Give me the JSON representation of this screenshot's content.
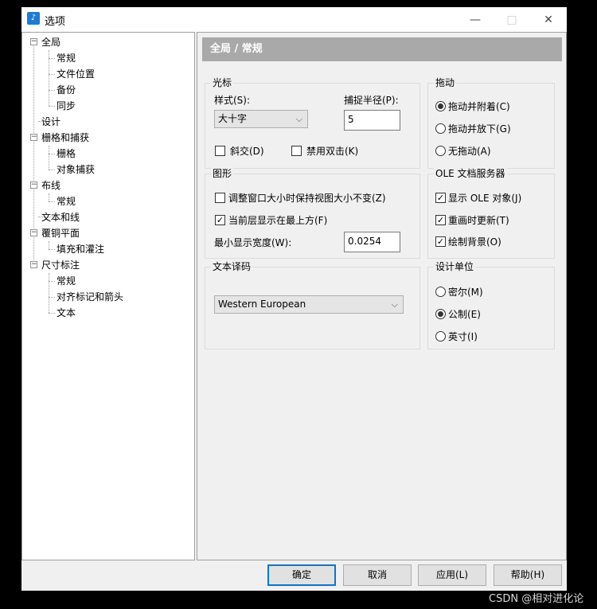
{
  "window": {
    "title": "选项",
    "minimize_glyph": "—",
    "maximize_glyph": "□",
    "close_glyph": "✕"
  },
  "tree": {
    "items": [
      {
        "label": "全局"
      },
      {
        "label": "常规"
      },
      {
        "label": "文件位置"
      },
      {
        "label": "备份"
      },
      {
        "label": "同步"
      },
      {
        "label": "设计"
      },
      {
        "label": "栅格和捕获"
      },
      {
        "label": "栅格"
      },
      {
        "label": "对象捕获"
      },
      {
        "label": "布线"
      },
      {
        "label": "常规"
      },
      {
        "label": "文本和线"
      },
      {
        "label": "覆铜平面"
      },
      {
        "label": "填充和灌注"
      },
      {
        "label": "尺寸标注"
      },
      {
        "label": "常规"
      },
      {
        "label": "对齐标记和箭头"
      },
      {
        "label": "文本"
      }
    ]
  },
  "header": {
    "title": "全局 / 常规"
  },
  "cursor": {
    "title": "光标",
    "style_label": "样式(S):",
    "style_value": "大十字",
    "snap_label": "捕捉半径(P):",
    "snap_value": "5",
    "diagonal_label": "斜交(D)",
    "diagonal_checked": false,
    "disable_dblclick_label": "禁用双击(K)",
    "disable_dblclick_checked": false
  },
  "drag": {
    "title": "拖动",
    "options": [
      {
        "label": "拖动并附着(C)",
        "selected": true
      },
      {
        "label": "拖动并放下(G)",
        "selected": false
      },
      {
        "label": "无拖动(A)",
        "selected": false
      }
    ]
  },
  "graphics": {
    "title": "图形",
    "keep_view_label": "调整窗口大小时保持视图大小不变(Z)",
    "keep_view_checked": false,
    "current_layer_top_label": "当前层显示在最上方(F)",
    "current_layer_top_checked": true,
    "min_width_label": "最小显示宽度(W):",
    "min_width_value": "0.0254"
  },
  "ole": {
    "title": "OLE 文档服务器",
    "items": [
      {
        "label": "显示 OLE 对象(J)",
        "checked": true
      },
      {
        "label": "重画时更新(T)",
        "checked": true
      },
      {
        "label": "绘制背景(O)",
        "checked": true
      }
    ]
  },
  "text_encoding": {
    "title": "文本译码",
    "value": "Western European"
  },
  "units": {
    "title": "设计单位",
    "options": [
      {
        "label": "密尔(M)",
        "selected": false
      },
      {
        "label": "公制(E)",
        "selected": true
      },
      {
        "label": "英寸(I)",
        "selected": false
      }
    ]
  },
  "buttons": {
    "ok": "确定",
    "cancel": "取消",
    "apply": "应用(L)",
    "help": "帮助(H)"
  },
  "watermark": "CSDN @相对进化论",
  "glyphs": {
    "check": "✓",
    "collapse": "−",
    "chevron": "⌵",
    "app_icon": "♪"
  }
}
